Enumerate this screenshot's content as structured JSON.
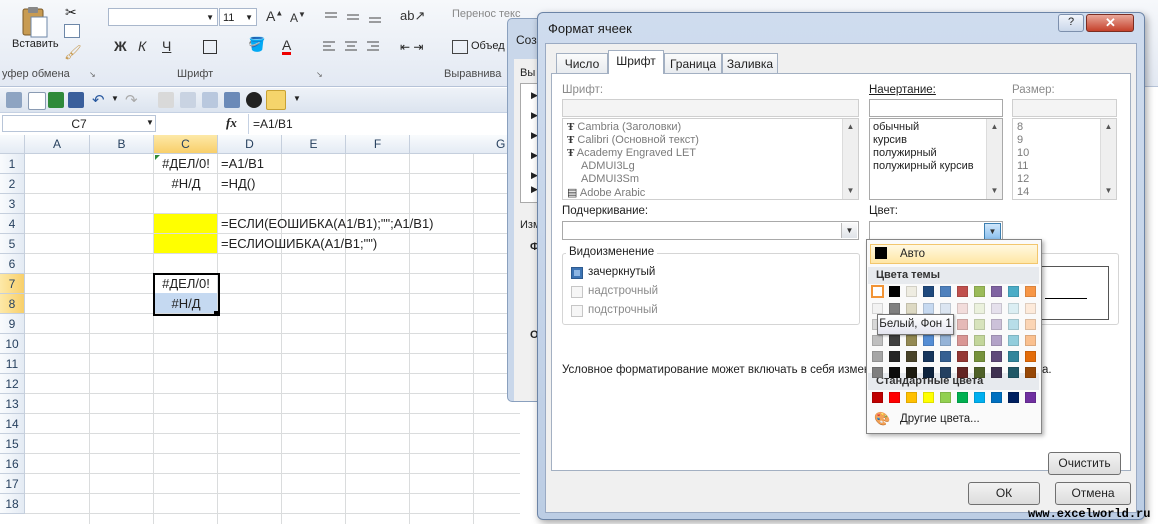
{
  "ribbon": {
    "paste_label": "Вставить",
    "clipboard_group": "уфер обмена",
    "font_group": "Шрифт",
    "align_group": "Выравнива",
    "font_size": "11",
    "wrap_text": "Перенос текс",
    "merge": "Объед",
    "bold": "Ж",
    "italic": "К",
    "underline": "Ч"
  },
  "formula_bar": {
    "name_box": "C7",
    "fx": "fx",
    "formula": "=A1/B1"
  },
  "sheet": {
    "columns": [
      "A",
      "B",
      "C",
      "D",
      "E",
      "F",
      "G"
    ],
    "rows": [
      "1",
      "2",
      "3",
      "4",
      "5",
      "6",
      "7",
      "8",
      "9",
      "10",
      "11",
      "12",
      "13",
      "14",
      "15",
      "16",
      "17",
      "18"
    ],
    "cells": {
      "c1": "#ДЕЛ/0!",
      "d1": "=A1/B1",
      "c2": "#Н/Д",
      "d2": "=НД()",
      "d4": "=ЕСЛИ(ЕОШИБКА(A1/B1);\"\";A1/B1)",
      "d5": "=ЕСЛИОШИБКА(A1/B1;\"\")",
      "c7": "#ДЕЛ/0!",
      "c8": "#Н/Д"
    },
    "highlight_color": "#ffff00",
    "selection_color": "#c5d9f1"
  },
  "back_dialog": {
    "title": "Соз",
    "label1": "Вы",
    "label2": "Изм",
    "label3": "Ф",
    "label4": "О"
  },
  "dialog": {
    "title": "Формат ячеек",
    "tabs": [
      "Число",
      "Шрифт",
      "Граница",
      "Заливка"
    ],
    "font_label": "Шрифт:",
    "style_label": "Начертание:",
    "size_label": "Размер:",
    "fonts": [
      "Cambria (Заголовки)",
      "Calibri (Основной текст)",
      "Academy Engraved LET",
      "ADMUI3Lg",
      "ADMUI3Sm",
      "Adobe Arabic"
    ],
    "styles": [
      "обычный",
      "курсив",
      "полужирный",
      "полужирный курсив"
    ],
    "sizes": [
      "8",
      "9",
      "10",
      "11",
      "12",
      "14"
    ],
    "underline_label": "Подчеркивание:",
    "color_label": "Цвет:",
    "effects_label": "Видоизменение",
    "strikethrough": "зачеркнутый",
    "superscript": "надстрочный",
    "subscript": "подстрочный",
    "note": "Условное форматирование может включать в себя изменен",
    "note_tail": "а.",
    "clear_button": "Очистить",
    "ok_button": "ОК",
    "cancel_button": "Отмена"
  },
  "color_popup": {
    "auto_label": "Авто",
    "theme_header": "Цвета темы",
    "standard_header": "Стандартные цвета",
    "more_colors": "Другие цвета...",
    "tooltip": "Белый, Фон 1",
    "theme_top": [
      "#ffffff",
      "#000000",
      "#eeece1",
      "#1f497d",
      "#4f81bd",
      "#c0504d",
      "#9bbb59",
      "#8064a2",
      "#4bacc6",
      "#f79646"
    ],
    "theme_shades": [
      [
        "#f2f2f2",
        "#7f7f7f",
        "#ddd9c3",
        "#c6d9f0",
        "#dbe5f1",
        "#f2dcdb",
        "#ebf1dd",
        "#e5e0ec",
        "#dbeef3",
        "#fdeada"
      ],
      [
        "#d8d8d8",
        "#595959",
        "#c4bd97",
        "#8db3e2",
        "#b8cce4",
        "#e5b9b7",
        "#d7e3bc",
        "#ccc1d9",
        "#b7dde8",
        "#fbd5b5"
      ],
      [
        "#bfbfbf",
        "#3f3f3f",
        "#938953",
        "#548dd4",
        "#95b3d7",
        "#d99694",
        "#c3d69b",
        "#b2a2c7",
        "#92cddc",
        "#fac08f"
      ],
      [
        "#a5a5a5",
        "#262626",
        "#494429",
        "#17365d",
        "#366092",
        "#953734",
        "#76923c",
        "#5f497a",
        "#31859b",
        "#e36c09"
      ],
      [
        "#7f7f7f",
        "#0c0c0c",
        "#1d1b10",
        "#0f243e",
        "#244061",
        "#632423",
        "#4f6128",
        "#3f3151",
        "#205867",
        "#974806"
      ]
    ],
    "standard": [
      "#c00000",
      "#ff0000",
      "#ffc000",
      "#ffff00",
      "#92d050",
      "#00b050",
      "#00b0f0",
      "#0070c0",
      "#002060",
      "#7030a0"
    ]
  },
  "watermark": "www.excelworld.ru"
}
